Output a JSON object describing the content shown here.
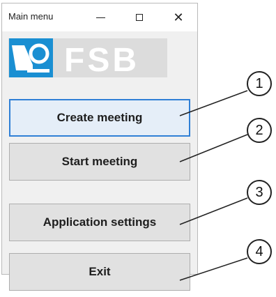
{
  "window": {
    "title": "Main menu",
    "minimize": "—",
    "maximize": "☐",
    "close": "✕"
  },
  "logo": {
    "text": "FSB",
    "brand_color": "#1a8fd2"
  },
  "menu": {
    "create_meeting": "Create meeting",
    "start_meeting": "Start meeting",
    "application_settings": "Application settings",
    "exit": "Exit"
  },
  "callouts": [
    "1",
    "2",
    "3",
    "4"
  ]
}
